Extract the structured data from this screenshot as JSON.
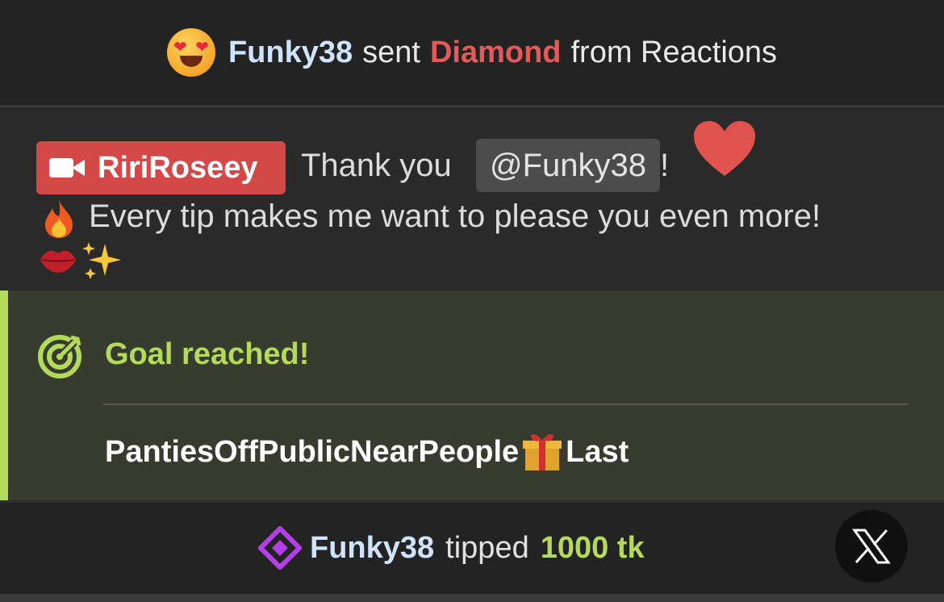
{
  "reaction": {
    "user": "Funky38",
    "verb": "sent",
    "item": "Diamond",
    "suffix": "from Reactions",
    "emoji": "heart-eyes-emoji"
  },
  "message": {
    "host": "RiriRoseey",
    "text_prefix": "Thank you",
    "mention": "@Funky38",
    "text_suffix": "!",
    "line2": "Every tip makes me want to please you even more!",
    "icons": [
      "video-camera-icon",
      "heart-icon",
      "fire-icon",
      "lips-icon",
      "sparkles-icon"
    ]
  },
  "goal": {
    "title": "Goal reached!",
    "name_part1": "PantiesOffPublicNearPeople",
    "name_part2": "Last",
    "accent_color": "#b3da5a",
    "icons": [
      "target-icon",
      "gift-icon"
    ]
  },
  "tip": {
    "user": "Funky38",
    "verb": "tipped",
    "amount": "1000 tk",
    "icons": [
      "diamond-icon",
      "x-logo-icon"
    ]
  },
  "colors": {
    "host_badge": "#d54848",
    "diamond_text": "#e35a5a",
    "username": "#cfe3ff",
    "tip_diamond": "#b23fe8"
  }
}
